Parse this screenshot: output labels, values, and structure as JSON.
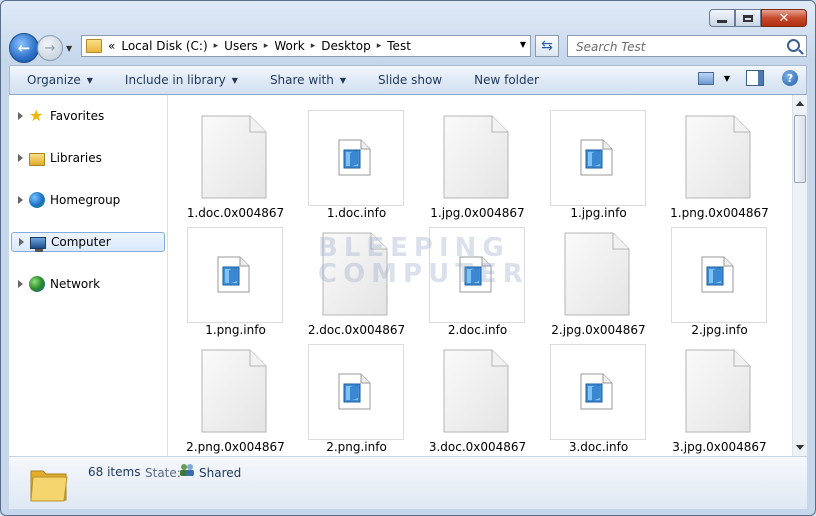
{
  "window": {
    "close_glyph": "✕",
    "title_buttons": [
      "minimize",
      "maximize",
      "close"
    ]
  },
  "address": {
    "overflow": "«",
    "crumbs": [
      "Local Disk (C:)",
      "Users",
      "Work",
      "Desktop",
      "Test"
    ],
    "separator": "▸"
  },
  "search": {
    "placeholder": "Search Test"
  },
  "toolbar": {
    "organize": "Organize",
    "include_in_library": "Include in library",
    "share_with": "Share with",
    "slide_show": "Slide show",
    "new_folder": "New folder",
    "help": "?"
  },
  "sidebar": {
    "items": [
      {
        "label": "Favorites",
        "icon": "star-icon"
      },
      {
        "label": "Libraries",
        "icon": "libraries-icon"
      },
      {
        "label": "Homegroup",
        "icon": "homegroup-icon"
      },
      {
        "label": "Computer",
        "icon": "computer-icon",
        "selected": true
      },
      {
        "label": "Network",
        "icon": "network-icon"
      }
    ]
  },
  "watermark": {
    "line1": "BLEEPING",
    "line2": "COMPUTER"
  },
  "files": [
    {
      "name": "1.doc.0x004867",
      "kind": "blank"
    },
    {
      "name": "1.doc.info",
      "kind": "thumb"
    },
    {
      "name": "1.jpg.0x004867",
      "kind": "blank"
    },
    {
      "name": "1.jpg.info",
      "kind": "thumb"
    },
    {
      "name": "1.png.0x004867",
      "kind": "blank"
    },
    {
      "name": "1.png.info",
      "kind": "thumb"
    },
    {
      "name": "2.doc.0x004867",
      "kind": "blank"
    },
    {
      "name": "2.doc.info",
      "kind": "thumb"
    },
    {
      "name": "2.jpg.0x004867",
      "kind": "blank"
    },
    {
      "name": "2.jpg.info",
      "kind": "thumb"
    },
    {
      "name": "2.png.0x004867",
      "kind": "blank"
    },
    {
      "name": "2.png.info",
      "kind": "thumb"
    },
    {
      "name": "3.doc.0x004867",
      "kind": "blank"
    },
    {
      "name": "3.doc.info",
      "kind": "thumb"
    },
    {
      "name": "3.jpg.0x004867",
      "kind": "blank"
    }
  ],
  "status": {
    "count": "68 items",
    "state_label": "State:",
    "state_value": "Shared"
  },
  "colors": {
    "accent": "#1e395b",
    "selection": "#d9e9fb",
    "close_button": "#c84a2c"
  }
}
